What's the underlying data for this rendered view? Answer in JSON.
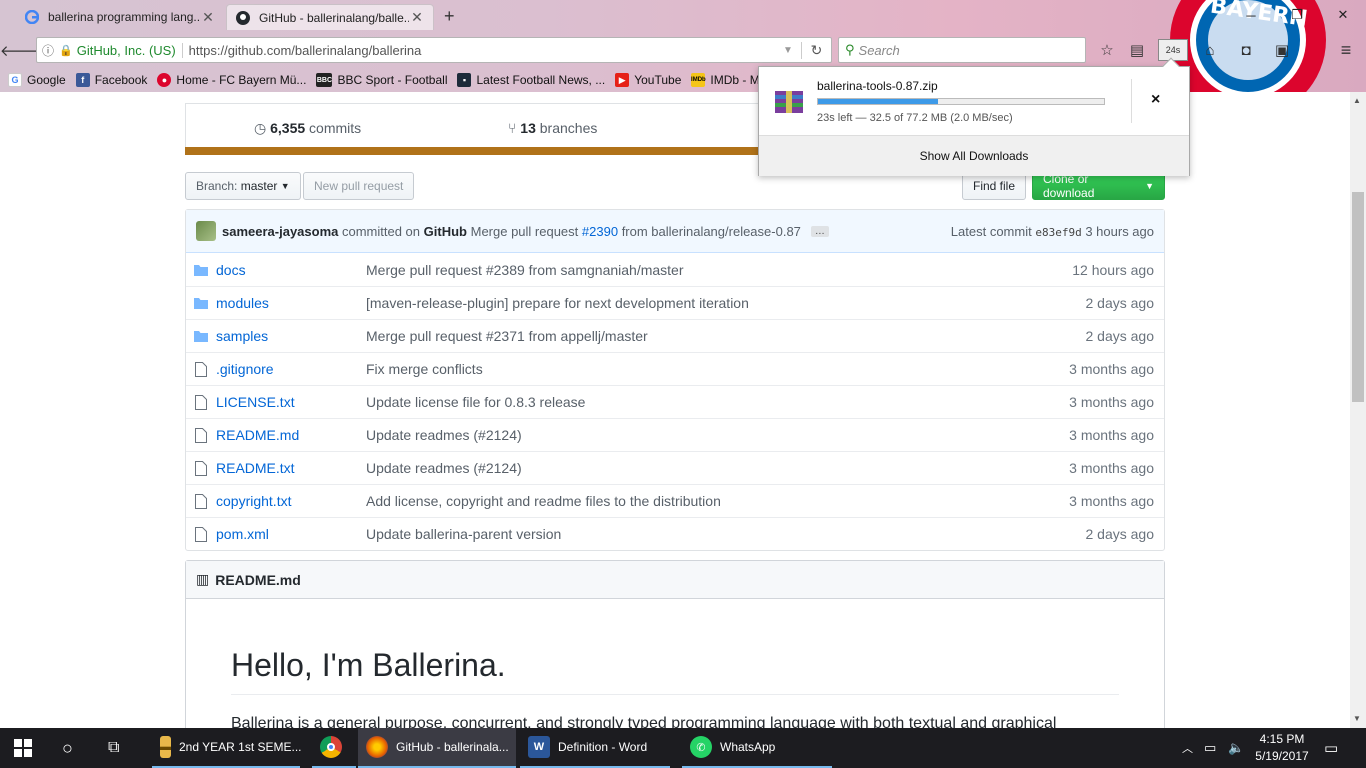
{
  "browser": {
    "tabs": [
      {
        "title": "ballerina programming lang...",
        "icon": "google-icon"
      },
      {
        "title": "GitHub - ballerinalang/balle...",
        "icon": "github-icon"
      }
    ],
    "new_tab": "+",
    "url_org": "GitHub, Inc. (US)",
    "url": "https://github.com/ballerinalang/ballerina",
    "search_placeholder": "Search",
    "download_badge": "24s",
    "bookmarks": [
      {
        "label": "Google",
        "icon": "google-icon",
        "color": "#ffffff"
      },
      {
        "label": "Facebook",
        "icon": "facebook-icon",
        "color": "#3b5998"
      },
      {
        "label": "Home - FC Bayern Mü...",
        "icon": "bayern-icon",
        "color": "#dc052d"
      },
      {
        "label": "BBC Sport - Football",
        "icon": "bbc-icon",
        "color": "#222222"
      },
      {
        "label": "Latest Football News, ...",
        "icon": "news-icon",
        "color": "#1c2b3a"
      },
      {
        "label": "YouTube",
        "icon": "youtube-icon",
        "color": "#e62117"
      },
      {
        "label": "IMDb - Mo",
        "icon": "imdb-icon",
        "color": "#f5c518"
      }
    ]
  },
  "download": {
    "filename": "ballerina-tools-0.87.zip",
    "progress": 0.42,
    "status": "23s left — 32.5 of 77.2 MB (2.0 MB/sec)",
    "close": "×",
    "show_all": "Show All Downloads"
  },
  "repo": {
    "commits_count": "6,355",
    "commits_label": "commits",
    "branches_count": "13",
    "branches_label": "branches",
    "lang_color": "#b07219",
    "branch_label": "Branch:",
    "branch_value": "master",
    "new_pr": "New pull request",
    "find_file": "Find file",
    "clone": "Clone or download",
    "latest": {
      "author": "sameera-jayasoma",
      "action": "committed on",
      "on": "GitHub",
      "msg_pre": "Merge pull request",
      "pr": "#2390",
      "msg_post": "from ballerinalang/release-0.87",
      "more": "…",
      "latest_label": "Latest commit",
      "sha": "e83ef9d",
      "time": "3 hours ago"
    },
    "files": [
      {
        "name": "docs",
        "type": "dir",
        "message": "Merge pull request #2389 from samgnaniah/master",
        "age": "12 hours ago"
      },
      {
        "name": "modules",
        "type": "dir",
        "message": "[maven-release-plugin] prepare for next development iteration",
        "age": "2 days ago"
      },
      {
        "name": "samples",
        "type": "dir",
        "message": "Merge pull request #2371 from appellj/master",
        "age": "2 days ago"
      },
      {
        "name": ".gitignore",
        "type": "file",
        "message": "Fix merge conflicts",
        "age": "3 months ago"
      },
      {
        "name": "LICENSE.txt",
        "type": "file",
        "message": "Update license file for 0.8.3 release",
        "age": "3 months ago"
      },
      {
        "name": "README.md",
        "type": "file",
        "message": "Update readmes (#2124)",
        "age": "3 months ago"
      },
      {
        "name": "README.txt",
        "type": "file",
        "message": "Update readmes (#2124)",
        "age": "3 months ago"
      },
      {
        "name": "copyright.txt",
        "type": "file",
        "message": "Add license, copyright and readme files to the distribution",
        "age": "3 months ago"
      },
      {
        "name": "pom.xml",
        "type": "file",
        "message": "Update ballerina-parent version",
        "age": "2 days ago"
      }
    ],
    "readme": {
      "header": "README.md",
      "title": "Hello, I'm Ballerina.",
      "intro": "Ballerina is a general purpose, concurrent, and strongly typed programming language with both textual and graphical"
    }
  },
  "taskbar": {
    "apps": [
      {
        "label": "2nd YEAR 1st SEME...",
        "icon": "folder-icon",
        "color": "#e8b84a"
      },
      {
        "label": "",
        "icon": "chrome-icon",
        "color": "#4285f4"
      },
      {
        "label": "GitHub - ballerinala...",
        "icon": "firefox-icon",
        "color": "#e66000"
      },
      {
        "label": "Definition - Word",
        "icon": "word-icon",
        "color": "#2b579a"
      },
      {
        "label": "WhatsApp",
        "icon": "whatsapp-icon",
        "color": "#25d366"
      }
    ],
    "time": "4:15 PM",
    "date": "5/19/2017"
  }
}
